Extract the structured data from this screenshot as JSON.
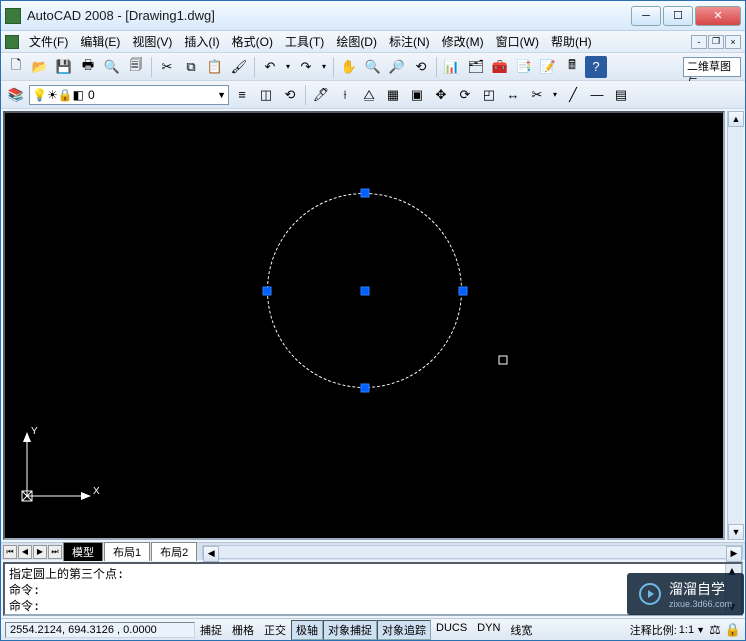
{
  "title": "AutoCAD 2008 - [Drawing1.dwg]",
  "menu": [
    "文件(F)",
    "编辑(E)",
    "视图(V)",
    "插入(I)",
    "格式(O)",
    "工具(T)",
    "绘图(D)",
    "标注(N)",
    "修改(M)",
    "窗口(W)",
    "帮助(H)"
  ],
  "workspace_input": "二维草图与",
  "layer": {
    "current": "0"
  },
  "tabs": {
    "items": [
      "模型",
      "布局1",
      "布局2"
    ],
    "active_index": 0
  },
  "command": {
    "lines": [
      "指定圆上的第三个点:",
      "命令:",
      "命令:"
    ]
  },
  "status": {
    "coords": "2554.2124, 694.3126 , 0.0000",
    "toggles": [
      "捕捉",
      "栅格",
      "正交",
      "极轴",
      "对象捕捉",
      "对象追踪",
      "DUCS",
      "DYN",
      "线宽"
    ],
    "pressed": [
      false,
      false,
      false,
      true,
      true,
      true,
      false,
      false,
      false
    ],
    "annoscale_label": "注释比例:",
    "annoscale_value": "1:1"
  },
  "watermark": {
    "main": "溜溜自学",
    "sub": "zixue.3d66.com"
  },
  "ucs": {
    "x": "X",
    "y": "Y"
  },
  "icons": {
    "new": "🗋",
    "open": "📂",
    "save": "💾",
    "plot": "🖶",
    "preview": "🔍",
    "publish": "🗐",
    "cut": "✂",
    "copy": "⧉",
    "paste": "📋",
    "match": "🖌",
    "undo": "↶",
    "redo": "↷",
    "pan": "✋",
    "zoomrt": "🔍",
    "zoomwin": "🔎",
    "zoomprev": "⟲",
    "props": "📊",
    "dc": "🗂",
    "tp": "🧰",
    "sheet": "📑",
    "markup": "📝",
    "calc": "🖩",
    "help": "?",
    "layerprops": "📚",
    "bulb": "💡",
    "sun": "☀",
    "lock": "🔒",
    "color": "◧",
    "layermgr": "≡",
    "layeriso": "◫",
    "layerprev": "⟲",
    "make": "🖊",
    "dim": "⟊",
    "mirror": "⧋",
    "array": "▦",
    "block": "▣",
    "move": "✥",
    "rotate": "⟳",
    "scale": "◰",
    "stretch": "↔",
    "trim": "✂",
    "line": "╱",
    "bylayer": "—"
  }
}
